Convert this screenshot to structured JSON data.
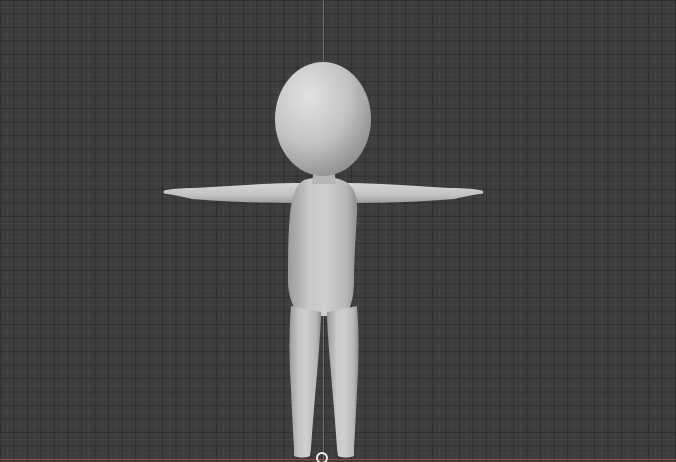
{
  "scene": {
    "object": "character-mesh",
    "view": "front-orthographic",
    "colors": {
      "background": "#3d3d3d",
      "grid": "#2f2f2f",
      "z_axis": "#4a7bd0",
      "x_axis": "#b24a4a",
      "mesh": "#c9c9c9"
    }
  }
}
